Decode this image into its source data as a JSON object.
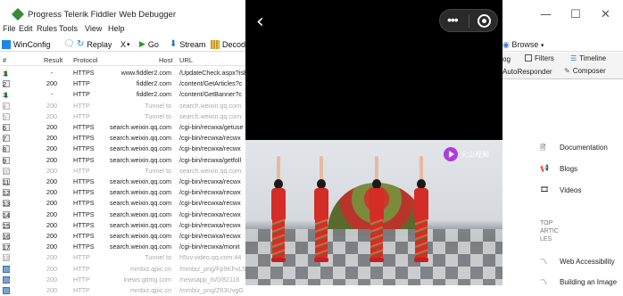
{
  "window": {
    "title": "Progress Telerik Fiddler Web Debugger",
    "minimize": "—",
    "maximize": "☐",
    "close": "✕"
  },
  "menu": [
    "File",
    "Edit",
    "Rules",
    "Tools",
    "View",
    "Help"
  ],
  "toolbar": {
    "winconfig": "WinConfig",
    "replay": "Replay",
    "remove": "X",
    "go": "Go",
    "stream": "Stream",
    "decode": "Decod",
    "browse": "Browse"
  },
  "grid": {
    "headers": {
      "num": "#",
      "result": "Result",
      "protocol": "Protocol",
      "host": "Host",
      "url": "URL"
    },
    "rows": [
      {
        "num": "1",
        "icon": "down-arrow-icon",
        "result": "-",
        "protocol": "HTTPS",
        "host": "www.fiddler2.com",
        "url": "/UpdateCheck.aspx?isE",
        "dim": false
      },
      {
        "num": "2",
        "icon": "document-icon",
        "result": "200",
        "protocol": "HTTP",
        "host": "fiddler2.com",
        "url": "/content/GetArticles?c",
        "dim": false
      },
      {
        "num": "3",
        "icon": "down-arrow-icon",
        "result": "-",
        "protocol": "HTTP",
        "host": "fiddler2.com",
        "url": "/content/GetBanner?c",
        "dim": false
      },
      {
        "num": "4",
        "icon": "lock-icon",
        "result": "200",
        "protocol": "HTTP",
        "host": "Tunnel to",
        "url": "search.weixin.qq.com:",
        "dim": true
      },
      {
        "num": "5",
        "icon": "lock-icon",
        "result": "200",
        "protocol": "HTTP",
        "host": "Tunnel to",
        "url": "search.weixin.qq.com:",
        "dim": true
      },
      {
        "num": "6",
        "icon": "document-icon",
        "result": "200",
        "protocol": "HTTPS",
        "host": "search.weixin.qq.com",
        "url": "/cgi-bin/recwxa/getuse",
        "dim": false
      },
      {
        "num": "7",
        "icon": "document-icon",
        "result": "200",
        "protocol": "HTTPS",
        "host": "search.weixin.qq.com",
        "url": "/cgi-bin/recwxa/recwx",
        "dim": false
      },
      {
        "num": "8",
        "icon": "script-icon",
        "result": "200",
        "protocol": "HTTPS",
        "host": "search.weixin.qq.com",
        "url": "/cgi-bin/recwxa/recwx",
        "dim": false
      },
      {
        "num": "9",
        "icon": "document-icon",
        "result": "200",
        "protocol": "HTTPS",
        "host": "search.weixin.qq.com",
        "url": "/cgi-bin/recwxa/getfoll",
        "dim": false
      },
      {
        "num": "10",
        "icon": "lock-icon",
        "result": "200",
        "protocol": "HTTP",
        "host": "Tunnel to",
        "url": "search.weixin.qq.com:",
        "dim": true
      },
      {
        "num": "11",
        "icon": "document-icon",
        "result": "200",
        "protocol": "HTTPS",
        "host": "search.weixin.qq.com",
        "url": "/cgi-bin/recwxa/recwx",
        "dim": false
      },
      {
        "num": "12",
        "icon": "document-icon",
        "result": "200",
        "protocol": "HTTPS",
        "host": "search.weixin.qq.com",
        "url": "/cgi-bin/recwxa/recwx",
        "dim": false
      },
      {
        "num": "13",
        "icon": "document-icon",
        "result": "200",
        "protocol": "HTTPS",
        "host": "search.weixin.qq.com",
        "url": "/cgi-bin/recwxa/recwx",
        "dim": false
      },
      {
        "num": "14",
        "icon": "document-icon",
        "result": "200",
        "protocol": "HTTPS",
        "host": "search.weixin.qq.com",
        "url": "/cgi-bin/recwxa/recwx",
        "dim": false
      },
      {
        "num": "15",
        "icon": "document-icon",
        "result": "200",
        "protocol": "HTTPS",
        "host": "search.weixin.qq.com",
        "url": "/cgi-bin/recwxa/recwx",
        "dim": false
      },
      {
        "num": "16",
        "icon": "document-icon",
        "result": "200",
        "protocol": "HTTPS",
        "host": "search.weixin.qq.com",
        "url": "/cgi-bin/recwxa/recwx",
        "dim": false
      },
      {
        "num": "17",
        "icon": "document-icon",
        "result": "200",
        "protocol": "HTTPS",
        "host": "search.weixin.qq.com",
        "url": "/cgi-bin/recwxa/monit",
        "dim": false
      },
      {
        "num": "18",
        "icon": "lock-icon",
        "result": "200",
        "protocol": "HTTP",
        "host": "Tunnel to",
        "url": "h5vv.video.qq.com:44",
        "dim": true
      },
      {
        "num": "19",
        "icon": "image-icon",
        "result": "200",
        "protocol": "HTTP",
        "host": "mmbiz.qpic.cn",
        "url": "/mmbiz_png/Fp9KFvL5",
        "dim": true
      },
      {
        "num": "20",
        "icon": "image-icon",
        "result": "200",
        "protocol": "HTTP",
        "host": "inews.gtimg.com",
        "url": "/newsapp_ls/0/82116",
        "dim": true
      },
      {
        "num": "21",
        "icon": "image-icon",
        "result": "200",
        "protocol": "HTTP",
        "host": "mmbiz.qpic.cn",
        "url": "/mmbiz_png/Z63UvgG",
        "dim": true
      }
    ]
  },
  "tabs": {
    "log": "og",
    "filters": "Filters",
    "timeline": "Timeline",
    "autoresponder": "AutoResponder",
    "composer": "Composer"
  },
  "overlay": {
    "back": "‹",
    "more": "•••",
    "watermark": "火山视频"
  },
  "right_panel": {
    "documentation": "Documentation",
    "blogs": "Blogs",
    "videos": "Videos",
    "top_articles": [
      "TOP",
      "ARTIC",
      "LES"
    ],
    "web_accessibility": "Web Accessibility",
    "building_image": "Building an Image"
  }
}
